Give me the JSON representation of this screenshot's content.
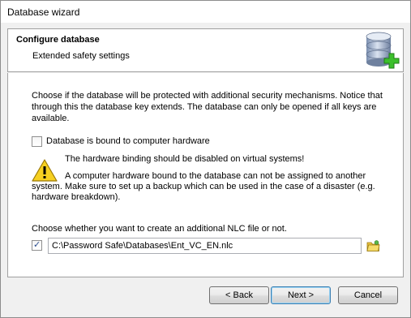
{
  "window": {
    "title": "Database wizard"
  },
  "header": {
    "title": "Configure database",
    "subtitle": "Extended safety settings",
    "icon": "database-add-icon"
  },
  "content": {
    "intro": "Choose if the database will be protected with additional security mechanisms. Notice that through this the database key extends. The database can only be opened if all keys are available.",
    "hardware_checkbox": {
      "label": "Database is bound to computer hardware",
      "checked": false
    },
    "warning": {
      "icon": "warning-icon",
      "line1": "The hardware binding should be disabled on virtual systems!",
      "line2": "A computer hardware bound to the database can not be assigned to another system. Make sure to set up a backup which can be used in the case of a disaster (e.g. hardware breakdown)."
    },
    "nlc_text": "Choose whether you want to create an additional NLC file or not.",
    "nlc_checkbox": {
      "checked": true
    },
    "nlc_path": "C:\\Password Safe\\Databases\\Ent_VC_EN.nlc",
    "browse_icon": "folder-icon"
  },
  "buttons": {
    "back": "< Back",
    "next": "Next >",
    "cancel": "Cancel"
  }
}
